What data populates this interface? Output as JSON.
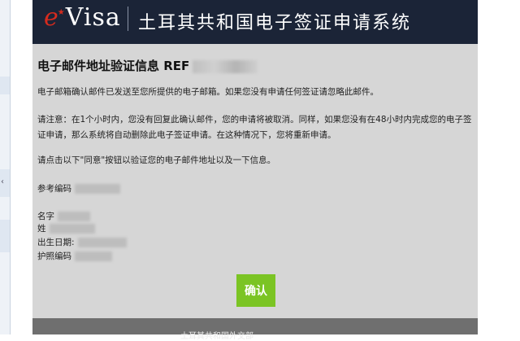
{
  "header": {
    "logo_prefix": "e",
    "logo_rest": "Visa",
    "title": "土耳其共和国电子签证申请系统"
  },
  "email": {
    "heading": "电子邮件地址验证信息 REF",
    "para1": "电子邮箱确认邮件已发送至您所提供的电子邮箱。如果您没有申请任何签证请忽略此邮件。",
    "para2": "请注意：在1个小时内，您没有回复此确认邮件，您的申请将被取消。同样，如果您没有在48小时内完成您的电子签证申请，那么系统将自动删除此电子签证申请。在这种情况下，您将重新申请。",
    "para3": "请点击以下\"同意\"按钮以验证您的电子邮件地址以及一下信息。",
    "fields": {
      "reference_label": "参考编码",
      "name_label": "名字",
      "surname_label": "姓",
      "dob_label": "出生日期:",
      "passport_label": "护照编码"
    },
    "confirm_label": "确认",
    "footer_text": "土耳其共和国外交部"
  },
  "icons": {
    "logo_mark": "star-icon"
  },
  "colors": {
    "header_bg": "#1b2437",
    "panel_bg": "#d6d6d6",
    "confirm_green": "#7bc424",
    "logo_red": "#d52b1e"
  }
}
